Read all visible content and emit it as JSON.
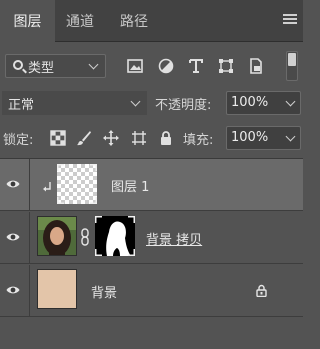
{
  "tabs": [
    {
      "label": "图层"
    },
    {
      "label": "通道"
    },
    {
      "label": "路径"
    }
  ],
  "filter": {
    "kind_label": "类型",
    "icons": [
      "image-filter-icon",
      "adjustment-filter-icon",
      "type-filter-icon",
      "shape-filter-icon",
      "smart-object-filter-icon"
    ]
  },
  "blend": {
    "mode": "正常",
    "opacity_label": "不透明度:",
    "opacity_value": "100%"
  },
  "lock": {
    "label": "锁定:",
    "icons": [
      "lock-transparent-pixels-icon",
      "lock-image-pixels-icon",
      "lock-position-icon",
      "lock-artboard-icon",
      "lock-all-icon"
    ],
    "fill_label": "填充:",
    "fill_value": "100%"
  },
  "layers": [
    {
      "name": "图层 1",
      "selected": true,
      "clipped": true
    },
    {
      "name": "背景 拷贝",
      "selected": false,
      "has_mask": true
    },
    {
      "name": "背景",
      "selected": false,
      "locked": true,
      "color": "#e3c5a9"
    }
  ],
  "colors": {
    "panel_bg": "#535353",
    "tabbar_bg": "#424242",
    "selected_layer_bg": "#6a6a6a",
    "background_layer_fill": "#e3c5a9"
  }
}
